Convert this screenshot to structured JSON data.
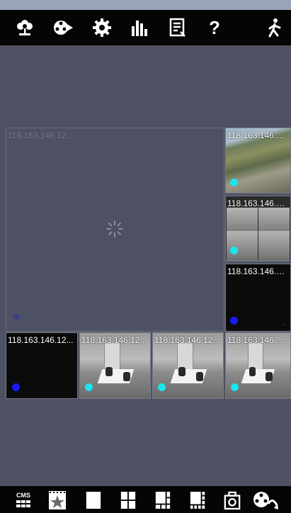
{
  "topbar": {
    "icons": [
      "flower-icon",
      "video-play-icon",
      "gear-icon",
      "bar-chart-icon",
      "document-list-icon",
      "help-icon",
      "walking-person-icon"
    ],
    "help_label": "?"
  },
  "main_tile": {
    "ip": "118.163.146.12..."
  },
  "side_tiles": [
    {
      "ip": "118.163.146.12..."
    },
    {
      "ip": "118.163.146.12..."
    },
    {
      "ip": "118.163.146.12..."
    }
  ],
  "bottom_row_tiles": [
    {
      "ip": "118.163.146.12..."
    },
    {
      "ip": "118.163.146.12..."
    },
    {
      "ip": "118.163.146.12..."
    },
    {
      "ip": "118.163.146.12..."
    }
  ],
  "bottombar": {
    "cms_label": "CMS",
    "icons": [
      "cms-grid-icon",
      "film-star-icon",
      "layout-1-icon",
      "layout-4-icon",
      "layout-6-icon",
      "layout-8-icon",
      "camera-snapshot-icon",
      "ptz-icon"
    ]
  },
  "colors": {
    "status_blue": "#1a1aff",
    "status_cyan": "#19e6ee",
    "background": "#4d5162"
  }
}
